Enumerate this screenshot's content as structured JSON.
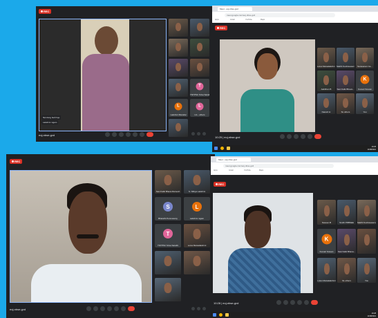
{
  "screenshot_1": {
    "rec": "REC",
    "caption": "Nội dung buổi họp",
    "main_name": "Lakshmi mgam",
    "meeting_code": "eoj-nbse-gvd",
    "tiles": [
      {
        "name": "",
        "kind": "video"
      },
      {
        "name": "",
        "kind": "video"
      },
      {
        "name": "",
        "kind": "video"
      },
      {
        "name": "",
        "kind": "video"
      },
      {
        "name": "",
        "kind": "video"
      },
      {
        "name": "",
        "kind": "video"
      },
      {
        "name": "",
        "kind": "video"
      },
      {
        "name": "TNTPSC Sriva Sarathi",
        "kind": "avatar",
        "letter": "T",
        "color": "#e06599"
      },
      {
        "name": "Lakshmi Marudai",
        "kind": "avatar",
        "letter": "L",
        "color": "#e8710a"
      },
      {
        "name": "LG - others",
        "kind": "avatar",
        "letter": "L",
        "color": "#e06599"
      },
      {
        "name": "",
        "kind": "video"
      }
    ]
  },
  "screenshot_2": {
    "tab_label": "Meet - eoj-nbse-gvd",
    "url": "meet.google.com/eoj-nbse-gvd",
    "bookmarks": [
      "Apps",
      "Gmail",
      "YouTube",
      "Maps"
    ],
    "rec": "REC",
    "meeting_code": "eoj-nbse-gvd",
    "time_label": "10:25",
    "clock": "10:25\n11/08/2021",
    "tiles": [
      {
        "name": "Lotus Metsalakshmi",
        "kind": "video"
      },
      {
        "name": "Sakthi Keshavasamy",
        "kind": "video"
      },
      {
        "name": "Saravanan Ca...",
        "kind": "video"
      },
      {
        "name": "Aabithan B",
        "kind": "video"
      },
      {
        "name": "Savi Kalki Bhava...",
        "kind": "video"
      },
      {
        "name": "Kumari Sravan",
        "kind": "avatar",
        "letter": "K",
        "color": "#e8710a"
      },
      {
        "name": "Naresh H",
        "kind": "video"
      },
      {
        "name": "SL others",
        "kind": "video"
      },
      {
        "name": "You",
        "kind": "video"
      }
    ]
  },
  "screenshot_3": {
    "rec": "REC",
    "meeting_code": "eoj-nbse-gvd",
    "tiles": [
      {
        "name": "Savi Kalki Bhava Ramesh",
        "kind": "video"
      },
      {
        "name": "S. Nithya Lakshmi",
        "kind": "video"
      },
      {
        "name": "Bharathi Ponnusamy",
        "kind": "avatar",
        "letter": "S",
        "color": "#7986cb"
      },
      {
        "name": "Lakshmi mgam",
        "kind": "avatar",
        "letter": "L",
        "color": "#e8710a"
      },
      {
        "name": "TNTPSC Sriva Sarathi",
        "kind": "avatar",
        "letter": "T",
        "color": "#e06599"
      },
      {
        "name": "Lotus Metsalakshmi",
        "kind": "video"
      },
      {
        "name": "",
        "kind": "video"
      },
      {
        "name": "",
        "kind": "video"
      },
      {
        "name": "",
        "kind": "video"
      }
    ]
  },
  "screenshot_4": {
    "tab_label": "Meet - eoj-nbse-gvd",
    "url": "meet.google.com/eoj-nbse-gvd",
    "bookmarks": [
      "Apps",
      "Gmail",
      "YouTube",
      "Maps"
    ],
    "rec": "REC",
    "meeting_code": "eoj-nbse-gvd",
    "time_label": "10:28",
    "clock": "10:28\n11/08/2021",
    "tiles": [
      {
        "name": "Naveen B",
        "kind": "video"
      },
      {
        "name": "Sruthi PRBSEE",
        "kind": "video"
      },
      {
        "name": "Sakthi Keshavasamy",
        "kind": "video"
      },
      {
        "name": "Kumari Sravan",
        "kind": "avatar",
        "letter": "K",
        "color": "#e8710a"
      },
      {
        "name": "Savi Kalki Bhava...",
        "kind": "video"
      },
      {
        "name": "",
        "kind": "video"
      },
      {
        "name": "Lotus Metsalakshmi",
        "kind": "video"
      },
      {
        "name": "SL others",
        "kind": "video"
      },
      {
        "name": "You",
        "kind": "video"
      }
    ]
  }
}
